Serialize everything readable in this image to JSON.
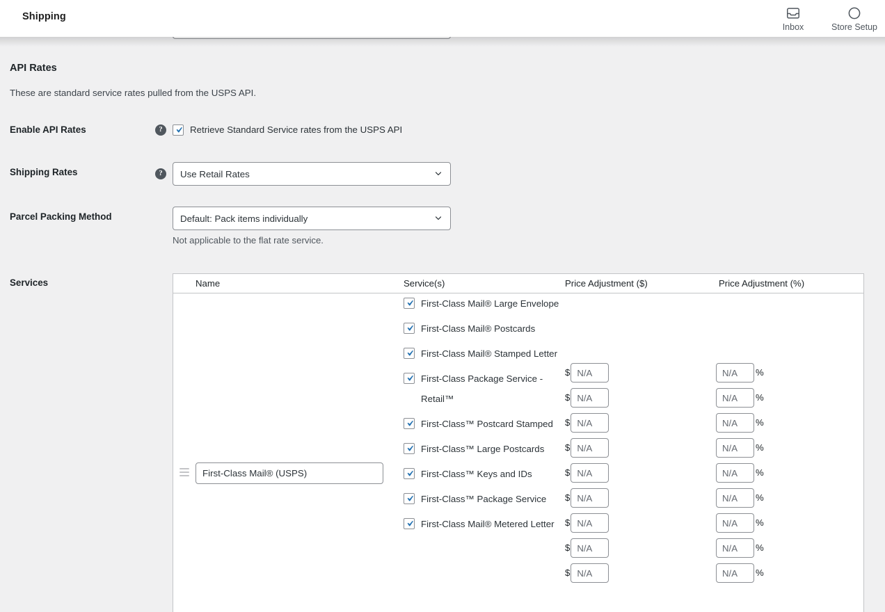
{
  "header": {
    "title": "Shipping",
    "actions": [
      {
        "label": "Inbox",
        "icon": "inbox-icon"
      },
      {
        "label": "Store Setup",
        "icon": "store-setup-progress-icon"
      }
    ]
  },
  "section": {
    "title": "API Rates",
    "description": "These are standard service rates pulled from the USPS API."
  },
  "fields": {
    "enable_api_rates": {
      "label": "Enable API Rates",
      "checkbox_label": "Retrieve Standard Service rates from the USPS API",
      "checked": true,
      "help": "?"
    },
    "shipping_rates": {
      "label": "Shipping Rates",
      "value": "Use Retail Rates",
      "help": "?"
    },
    "parcel_packing_method": {
      "label": "Parcel Packing Method",
      "value": "Default: Pack items individually",
      "note": "Not applicable to the flat rate service."
    },
    "services": {
      "label": "Services"
    }
  },
  "table": {
    "columns": [
      "Name",
      "Service(s)",
      "Price Adjustment ($)",
      "Price Adjustment (%)"
    ],
    "row": {
      "name_value": "First-Class Mail® (USPS)",
      "services": [
        {
          "label": "First-Class Mail® Large Envelope",
          "checked": true
        },
        {
          "label": "First-Class Mail® Postcards",
          "checked": true
        },
        {
          "label": "First-Class Mail® Stamped Letter",
          "checked": true
        },
        {
          "label": "First-Class Package Service - Retail™",
          "checked": true
        },
        {
          "label": "First-Class™ Postcard Stamped",
          "checked": true
        },
        {
          "label": "First-Class™ Large Postcards",
          "checked": true
        },
        {
          "label": "First-Class™ Keys and IDs",
          "checked": true
        },
        {
          "label": "First-Class™ Package Service",
          "checked": true
        },
        {
          "label": "First-Class Mail® Metered Letter",
          "checked": true
        }
      ],
      "price_adjustments_dollar": [
        {
          "symbol": "$",
          "placeholder": "N/A",
          "value": ""
        },
        {
          "symbol": "$",
          "placeholder": "N/A",
          "value": ""
        },
        {
          "symbol": "$",
          "placeholder": "N/A",
          "value": ""
        },
        {
          "symbol": "$",
          "placeholder": "N/A",
          "value": ""
        },
        {
          "symbol": "$",
          "placeholder": "N/A",
          "value": ""
        },
        {
          "symbol": "$",
          "placeholder": "N/A",
          "value": ""
        },
        {
          "symbol": "$",
          "placeholder": "N/A",
          "value": ""
        },
        {
          "symbol": "$",
          "placeholder": "N/A",
          "value": ""
        },
        {
          "symbol": "$",
          "placeholder": "N/A",
          "value": ""
        }
      ],
      "price_adjustments_percent": [
        {
          "symbol": "%",
          "placeholder": "N/A",
          "value": ""
        },
        {
          "symbol": "%",
          "placeholder": "N/A",
          "value": ""
        },
        {
          "symbol": "%",
          "placeholder": "N/A",
          "value": ""
        },
        {
          "symbol": "%",
          "placeholder": "N/A",
          "value": ""
        },
        {
          "symbol": "%",
          "placeholder": "N/A",
          "value": ""
        },
        {
          "symbol": "%",
          "placeholder": "N/A",
          "value": ""
        },
        {
          "symbol": "%",
          "placeholder": "N/A",
          "value": ""
        },
        {
          "symbol": "%",
          "placeholder": "N/A",
          "value": ""
        },
        {
          "symbol": "%",
          "placeholder": "N/A",
          "value": ""
        }
      ]
    }
  },
  "colors": {
    "background": "#f0f0f1",
    "surface": "#ffffff",
    "border": "#c3c4c7",
    "input_border": "#8c8f94",
    "text": "#1d2327",
    "muted_text": "#50575e",
    "checkbox_accent": "#2271b1"
  }
}
